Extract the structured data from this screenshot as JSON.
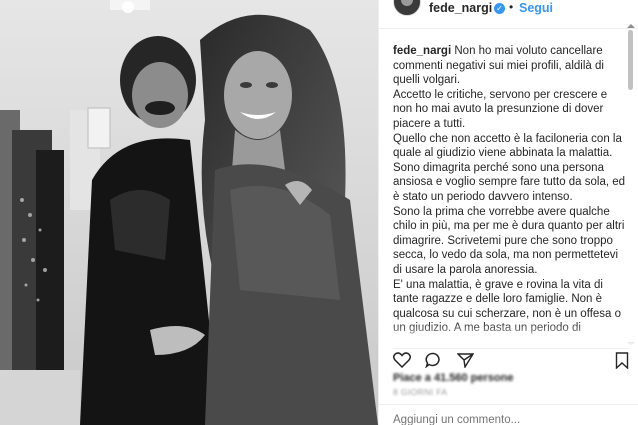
{
  "post": {
    "username": "fede_nargi",
    "follow_label": "Segui",
    "separator": "•",
    "verified_mark": "✓",
    "caption_user": "fede_nargi",
    "caption_paragraphs": [
      "Non ho mai voluto cancellare commenti negativi sui miei profili, aldilà di quelli volgari.",
      "Accetto le critiche, servono per crescere e non ho mai avuto la presunzione di dover piacere a tutti.",
      "Quello che non accetto è la faciloneria con la quale al giudizio viene abbinata la malattia.",
      "Sono dimagrita perché sono una persona ansiosa e voglio sempre fare tutto da sola, ed è stato un periodo davvero intenso.",
      "Sono la prima che vorrebbe avere qualche chilo in più, ma per me è dura quanto per altri dimagrire. Scrivetemi pure che sono troppo secca, lo vedo da sola, ma non permettetevi di usare la parola anoressia.",
      "E' una malattia, è grave e rovina la vita di tante ragazze e delle loro famiglie. Non è qualcosa su cui scherzare, non è un offesa o un giudizio. A me basta un periodo di"
    ],
    "likes_text": "Piace a 41.560 persone",
    "date_text": "8 GIORNI FA",
    "comment_placeholder": "Aggiungi un commento...",
    "more_icon": "•••"
  },
  "icons": {
    "like": "heart-icon",
    "comment": "comment-icon",
    "share": "share-icon",
    "save": "bookmark-icon"
  },
  "colors": {
    "accent_blue": "#3897f0",
    "text": "#262626",
    "muted": "#999999"
  }
}
